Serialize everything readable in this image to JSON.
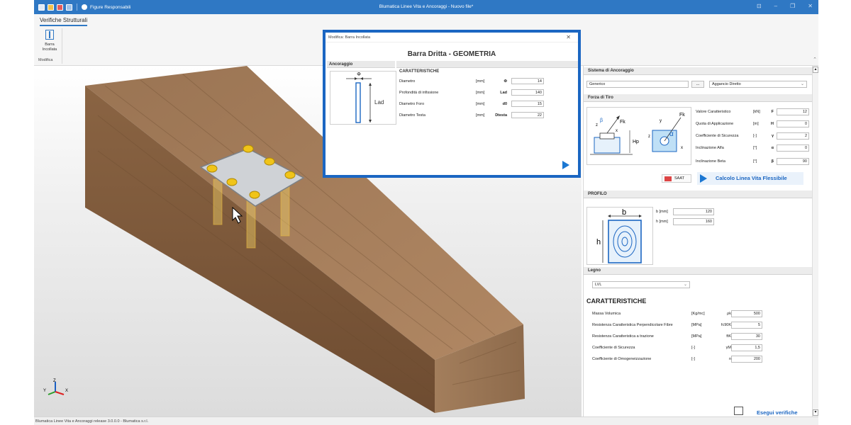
{
  "titlebar": {
    "title": "Blumatica Linee Vita e Ancoraggi - Nuovo file*",
    "figure_link": "Figure Responsabili"
  },
  "ribbon": {
    "tab": "Verifiche Strutturali",
    "button_label": "Barra\nIncollata",
    "group_label": "Modifica"
  },
  "modal": {
    "window_title": "Modifica: Barra Incollata",
    "title": "Barra Dritta - GEOMETRIA",
    "section": "Ancoraggio",
    "characteristics_title": "CARATTERISTICHE",
    "rows": [
      {
        "label": "Diametro",
        "unit": "[mm]",
        "symbol": "Φ",
        "value": "14"
      },
      {
        "label": "Profondità di infissione",
        "unit": "[mm]",
        "symbol": "Lad",
        "value": "140"
      },
      {
        "label": "Diametro Foro",
        "unit": "[mm]",
        "symbol": "d0",
        "value": "15"
      },
      {
        "label": "Diametro Testa",
        "unit": "[mm]",
        "symbol": "Dtesta",
        "value": "22"
      }
    ],
    "pic_phi": "Φ",
    "pic_lad": "Lad"
  },
  "panel": {
    "sistema": {
      "header": "Sistema di Ancoraggio",
      "field": "Generico",
      "dots": "...",
      "select": "Aggancio Diretto"
    },
    "forza": {
      "header": "Forza di Tiro",
      "rows": [
        {
          "label": "Valore Caratteristico",
          "unit": "[kN]",
          "symbol": "F",
          "value": "12"
        },
        {
          "label": "Quota di Applicazione",
          "unit": "[m]",
          "symbol": "H",
          "value": "0"
        },
        {
          "label": "Coefficiente di Sicurezza",
          "unit": "[-]",
          "symbol": "γ",
          "value": "2"
        },
        {
          "label": "Inclinazione Alfa",
          "unit": "[°]",
          "symbol": "α",
          "value": "0"
        },
        {
          "label": "Inclinazione Beta",
          "unit": "[°]",
          "symbol": "β",
          "value": "90"
        }
      ],
      "saat": "SAAT",
      "calc": "Calcolo Linea Vita Flessibile",
      "pic": {
        "beta": "β",
        "fk": "Fk",
        "z": "z",
        "x": "x",
        "y": "y",
        "hp": "Hp",
        "alpha": "α"
      }
    },
    "profilo": {
      "header": "PROFILO",
      "rows": [
        {
          "label": "b [mm]",
          "value": "120"
        },
        {
          "label": "h [mm]",
          "value": "160"
        }
      ],
      "pic": {
        "b": "b",
        "h": "h"
      }
    },
    "legno": {
      "header": "Legno",
      "select": "LVL",
      "characteristics_title": "CARATTERISTICHE",
      "rows": [
        {
          "label": "Massa Volumica",
          "unit": "[Kg/mc]",
          "symbol": "ρk",
          "value": "500"
        },
        {
          "label": "Resistenza Caratteristica Perpendicolare Fibre",
          "unit": "[MPa]",
          "symbol": "fc90K",
          "value": "5"
        },
        {
          "label": "Resistenza Caratteristica a trazione",
          "unit": "[MPa]",
          "symbol": "ftK",
          "value": "30"
        },
        {
          "label": "Coefficiente di Sicurezza",
          "unit": "[-]",
          "symbol": "γM",
          "value": "1,5"
        },
        {
          "label": "Coefficiente di Omogeneizzazione",
          "unit": "[-]",
          "symbol": "n",
          "value": "200"
        }
      ]
    },
    "verify": "Esegui verifiche"
  },
  "axes": {
    "x": "X",
    "y": "Y",
    "z": "Z"
  },
  "statusbar": "Blumatica Linee Vita e Ancoraggi release 3.0.0.0 - Blumatica s.r.l."
}
